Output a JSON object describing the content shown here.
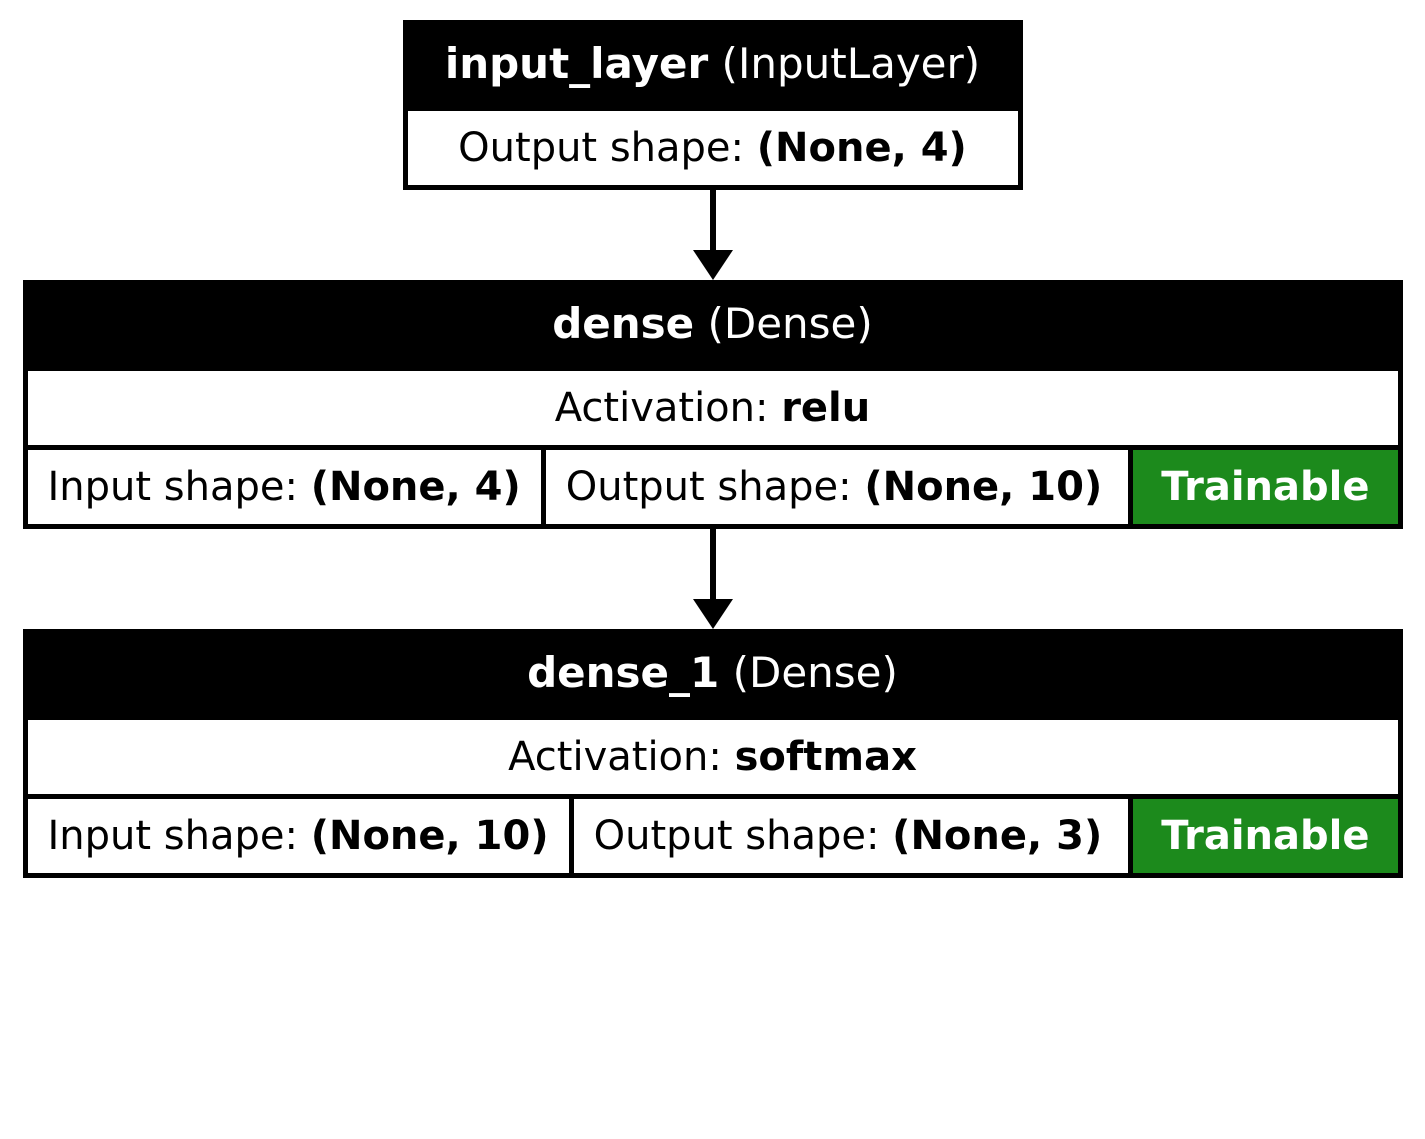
{
  "layers": [
    {
      "id": "input_layer",
      "name": "input_layer",
      "type": "InputLayer",
      "output_label": "Output shape:",
      "output_shape": "(None, 4)"
    },
    {
      "id": "dense",
      "name": "dense",
      "type": "Dense",
      "activation_label": "Activation:",
      "activation": "relu",
      "input_label": "Input shape:",
      "input_shape": "(None, 4)",
      "output_label": "Output shape:",
      "output_shape": "(None, 10)",
      "trainable_label": "Trainable"
    },
    {
      "id": "dense_1",
      "name": "dense_1",
      "type": "Dense",
      "activation_label": "Activation:",
      "activation": "softmax",
      "input_label": "Input shape:",
      "input_shape": "(None, 10)",
      "output_label": "Output shape:",
      "output_shape": "(None, 3)",
      "trainable_label": "Trainable"
    }
  ]
}
